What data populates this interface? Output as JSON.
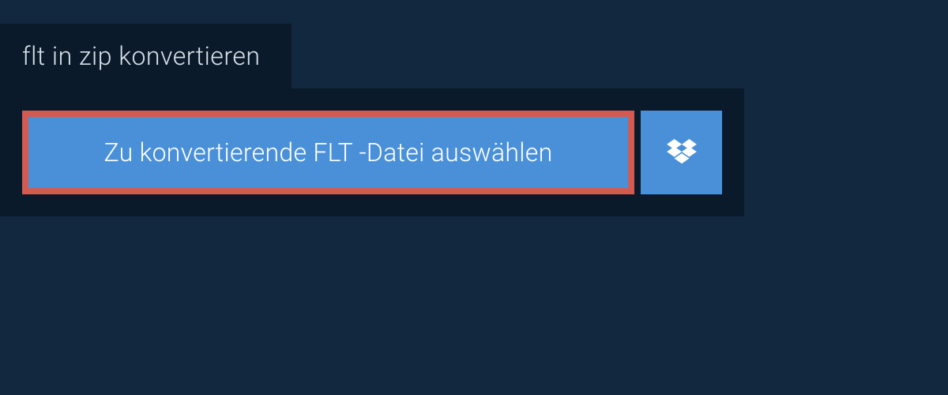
{
  "header": {
    "title": "flt in zip konvertieren"
  },
  "actions": {
    "select_file_label": "Zu konvertierende FLT -Datei auswählen"
  }
}
